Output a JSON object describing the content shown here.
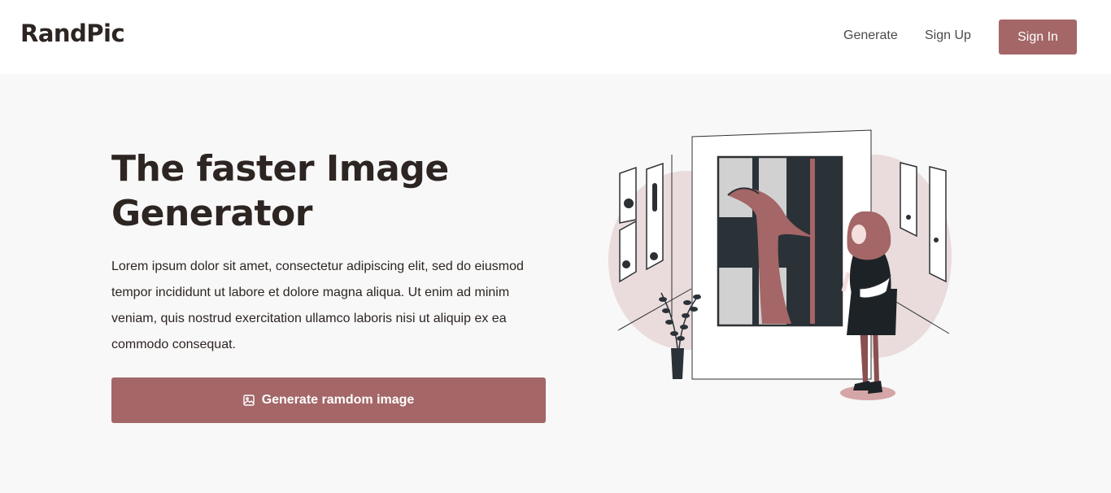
{
  "navbar": {
    "brand": "RandPic",
    "links": {
      "generate": "Generate",
      "sign_up": "Sign Up"
    },
    "sign_in_label": "Sign In"
  },
  "hero": {
    "title": "The faster Image Generator",
    "description": "Lorem ipsum dolor sit amet, consectetur adipiscing elit, sed do eiusmod tempor incididunt ut labore et dolore magna aliqua. Ut enim ad minim veniam, quis nostrud exercitation ullamco laboris nisi ut aliquip ex ea commodo consequat.",
    "cta": {
      "label": "Generate ramdom image",
      "icon": "image-icon"
    },
    "illustration": "woman-viewing-art-gallery-illustration"
  },
  "colors": {
    "accent": "#a46667",
    "dark": "#2d2522",
    "background": "#f8f8f8"
  }
}
